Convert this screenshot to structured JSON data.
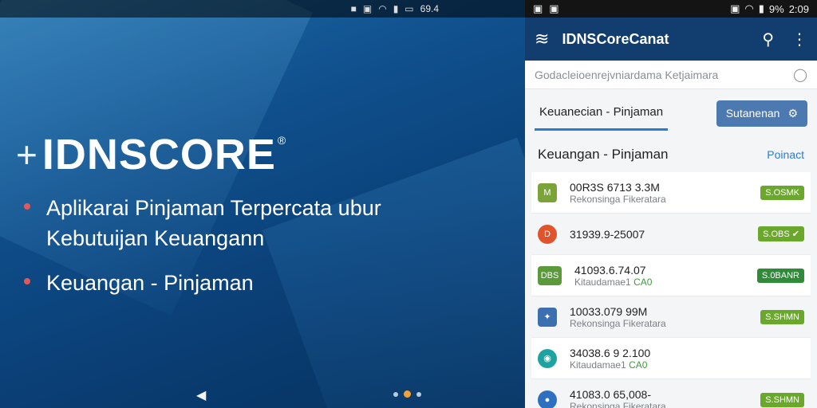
{
  "hero": {
    "status_text": "69.4",
    "brand": "IDNSCORE",
    "brand_reg": "®",
    "bullets": [
      "Aplikarai Pinjaman Terpercata ubur Kebutuijan Keuangann",
      "Keuangan - Pinjaman"
    ]
  },
  "phone": {
    "status": {
      "battery": "9%",
      "time": "2:09"
    },
    "appbar": {
      "title": "IDNSCoreCanat"
    },
    "search": {
      "placeholder": "Godacleioenrejvniardama Ketjaimara"
    },
    "tabs": {
      "active": "Keuanecian - Pinjaman",
      "button": "Sutanenan"
    },
    "section": {
      "title": "Keuangan - Pinjaman",
      "link": "Poinact"
    },
    "rows": [
      {
        "title": "00R3S 6713 3.3M",
        "sub": "Rekonsinga Fikeratara",
        "sub_hl": "",
        "badge": "S.OSMK",
        "icon": "M"
      },
      {
        "title": "31939.9-25007",
        "sub": "",
        "sub_hl": "",
        "badge": "S.OBS",
        "icon": "D"
      },
      {
        "title": "41093.6.74.07",
        "sub": "Kitaudamae1",
        "sub_hl": "CA0",
        "badge": "S.0BANR",
        "icon": "DBS"
      },
      {
        "title": "10033.079 99M",
        "sub": "Rekonsinga Fikeratara",
        "sub_hl": "",
        "badge": "S.SHMN",
        "icon": "✦"
      },
      {
        "title": "34038.6 9 2.100",
        "sub": "Kitaudamae1",
        "sub_hl": "CA0",
        "badge": "",
        "icon": "◉"
      },
      {
        "title": "41083.0 65,008-",
        "sub": "Rekonsinga Fikeratara",
        "sub_hl": "",
        "badge": "S.SHMN",
        "icon": "●"
      }
    ]
  },
  "colors": {
    "appbar": "#123d6f",
    "badge_green": "#6aa82c",
    "badge_dark_green": "#2f8a3a",
    "accent_blue": "#2b7bd4"
  }
}
